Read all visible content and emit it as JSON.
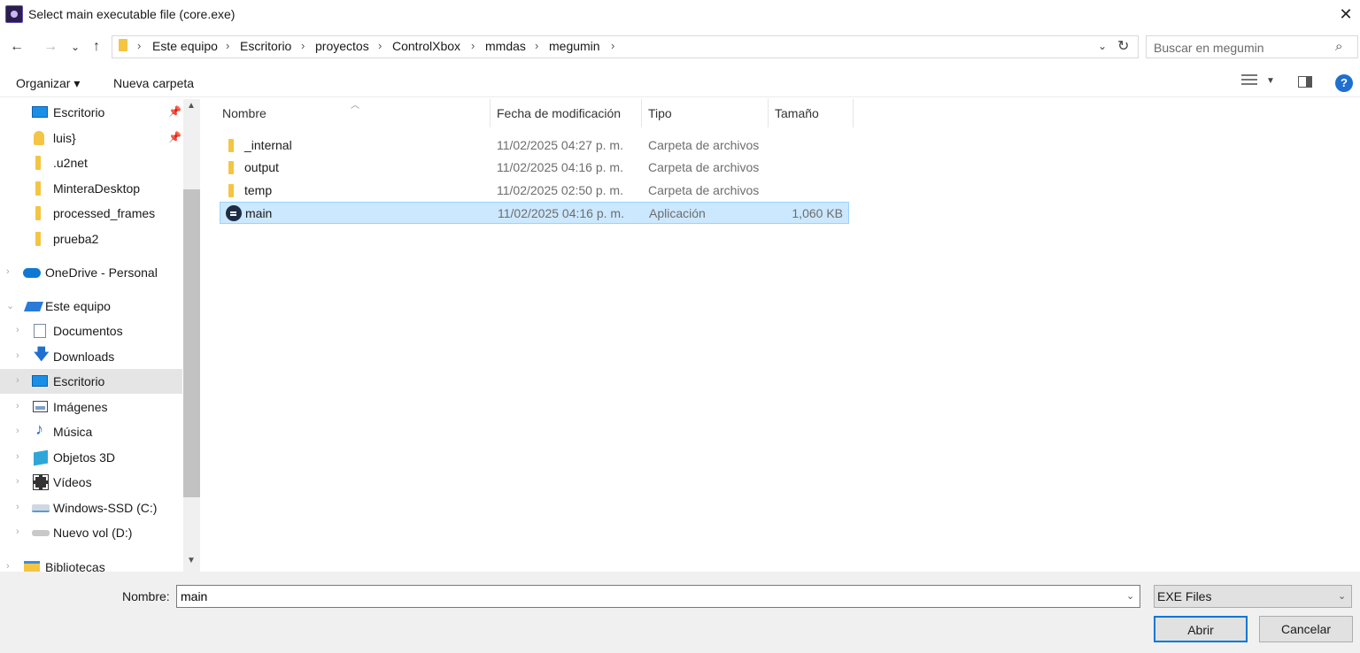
{
  "window": {
    "title": "Select main executable file (core.exe)",
    "close_glyph": "✕"
  },
  "nav": {
    "back": "←",
    "forward": "→",
    "recent": "⌄",
    "up": "↑",
    "breadcrumb": [
      "Este equipo",
      "Escritorio",
      "proyectos",
      "ControlXbox",
      "mmdas",
      "megumin"
    ],
    "separator": "›",
    "search_placeholder": "Buscar en megumin"
  },
  "toolbar": {
    "organize": "Organizar ▾",
    "new_folder": "Nueva carpeta",
    "help": "?"
  },
  "sidebar": {
    "items": [
      {
        "label": "Escritorio",
        "icon": "desktop-icon",
        "pinned": true
      },
      {
        "label": "luis}",
        "icon": "user-folder-icon",
        "pinned": true
      },
      {
        "label": ".u2net",
        "icon": "folder-icon"
      },
      {
        "label": "MinteraDesktop",
        "icon": "folder-icon"
      },
      {
        "label": "processed_frames",
        "icon": "folder-icon"
      },
      {
        "label": "prueba2",
        "icon": "folder-icon"
      },
      {
        "label": "OneDrive - Personal",
        "icon": "onedrive-icon"
      },
      {
        "label": "Este equipo",
        "icon": "this-pc-icon"
      },
      {
        "label": "Documentos",
        "icon": "documents-icon"
      },
      {
        "label": "Downloads",
        "icon": "downloads-icon"
      },
      {
        "label": "Escritorio",
        "icon": "desktop-icon",
        "selected": true
      },
      {
        "label": "Imágenes",
        "icon": "pictures-icon"
      },
      {
        "label": "Música",
        "icon": "music-icon"
      },
      {
        "label": "Objetos 3D",
        "icon": "3d-objects-icon"
      },
      {
        "label": "Vídeos",
        "icon": "videos-icon"
      },
      {
        "label": "Windows-SSD (C:)",
        "icon": "drive-c-icon"
      },
      {
        "label": "Nuevo vol (D:)",
        "icon": "drive-d-icon"
      },
      {
        "label": "Bibliotecas",
        "icon": "libraries-icon"
      }
    ]
  },
  "file_list": {
    "columns": {
      "name": "Nombre",
      "date": "Fecha de modificación",
      "type": "Tipo",
      "size": "Tamaño"
    },
    "rows": [
      {
        "name": "_internal",
        "date": "11/02/2025 04:27 p. m.",
        "type": "Carpeta de archivos",
        "size": ""
      },
      {
        "name": "output",
        "date": "11/02/2025 04:16 p. m.",
        "type": "Carpeta de archivos",
        "size": ""
      },
      {
        "name": "temp",
        "date": "11/02/2025 02:50 p. m.",
        "type": "Carpeta de archivos",
        "size": ""
      },
      {
        "name": "main",
        "date": "11/02/2025 04:16 p. m.",
        "type": "Aplicación",
        "size": "1,060 KB",
        "selected": true
      }
    ]
  },
  "footer": {
    "filename_label": "Nombre:",
    "filename_value": "main",
    "filter_value": "EXE Files",
    "open_button": "Abrir",
    "cancel_button": "Cancelar"
  }
}
